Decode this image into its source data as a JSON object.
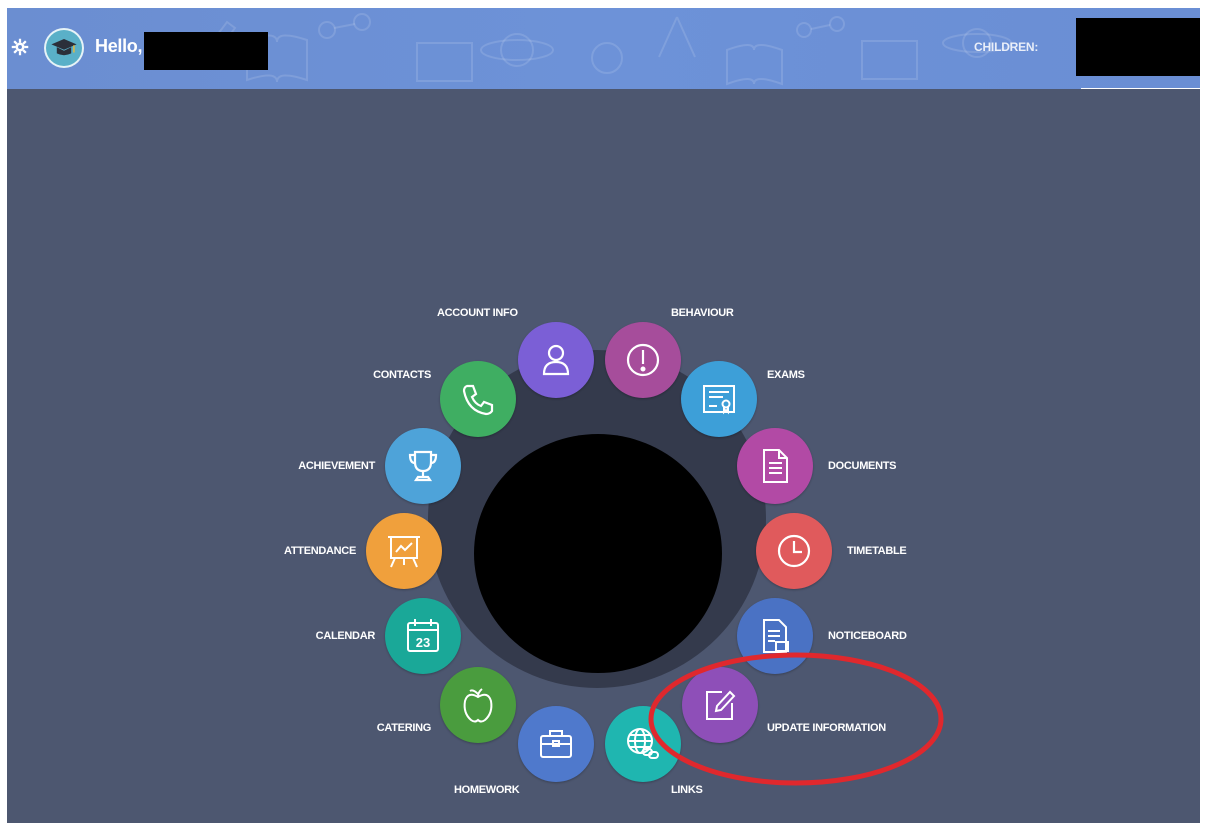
{
  "header": {
    "greeting": "Hello,",
    "children_label": "CHILDREN:"
  },
  "menu": {
    "account_info": "ACCOUNT INFO",
    "behaviour": "BEHAVIOUR",
    "contacts": "CONTACTS",
    "exams": "EXAMS",
    "achievement": "ACHIEVEMENT",
    "documents": "DOCUMENTS",
    "attendance": "ATTENDANCE",
    "timetable": "TIMETABLE",
    "calendar": "CALENDAR",
    "calendar_day": "23",
    "noticeboard": "NOTICEBOARD",
    "catering": "CATERING",
    "update_information": "UPDATE INFORMATION",
    "homework": "HOMEWORK",
    "links": "LINKS"
  },
  "colors": {
    "background": "#4d5770",
    "topbar": "#6d92d8",
    "account_info": "#7b5fd6",
    "behaviour": "#a64d9b",
    "exams": "#3d9fd8",
    "documents": "#b24aa5",
    "timetable": "#e05a5c",
    "noticeboard": "#4a72c4",
    "update_information": "#8e4fb8",
    "links": "#1fb6b0",
    "homework": "#4f79cc",
    "catering": "#4a9c3e",
    "calendar": "#1aa898",
    "attendance": "#f0a03c",
    "achievement": "#4ea3d9",
    "contacts": "#3fae62",
    "callout": "#e0282d"
  },
  "icons": {
    "settings": "gear-icon",
    "avatar": "graduation-cap-icon",
    "account_info": "user-icon",
    "behaviour": "exclamation-icon",
    "exams": "certificate-icon",
    "documents": "document-icon",
    "timetable": "clock-icon",
    "noticeboard": "notice-icon",
    "update_information": "edit-icon",
    "links": "globe-link-icon",
    "homework": "briefcase-icon",
    "catering": "apple-icon",
    "calendar": "calendar-icon",
    "attendance": "presentation-icon",
    "achievement": "trophy-icon",
    "contacts": "phone-icon"
  }
}
